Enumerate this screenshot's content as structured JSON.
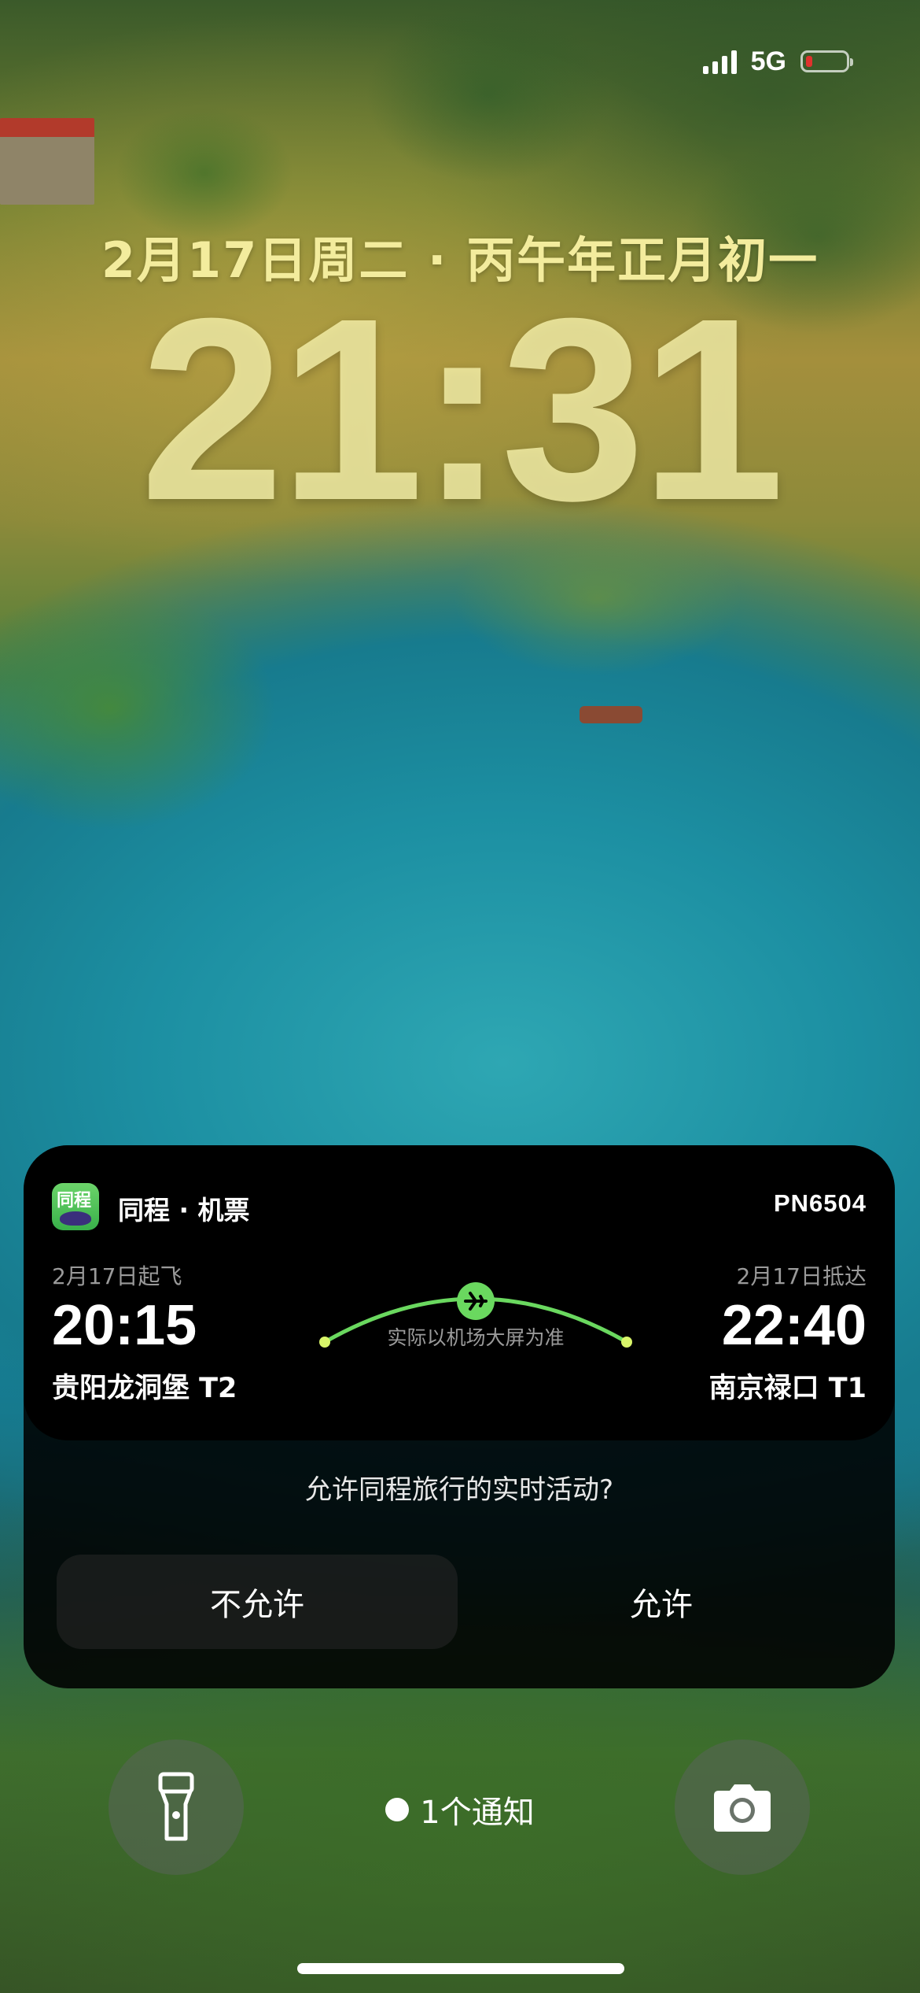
{
  "status_bar": {
    "network": "5G",
    "signal_bars": 4,
    "battery_level": 0.12,
    "battery_color": "#e0322d"
  },
  "lock_screen": {
    "date": "2月17日周二 · 丙午年正月初一",
    "time": "21:31",
    "clock_color": "#f3ec9d"
  },
  "live_activity": {
    "app_icon_text": "同程",
    "app_name": "同程 · 机票",
    "flight_number": "PN6504",
    "departure": {
      "date": "2月17日起飞",
      "time": "20:15",
      "airport": "贵阳龙洞堡 T2"
    },
    "arrival": {
      "date": "2月17日抵达",
      "time": "22:40",
      "airport": "南京禄口 T1"
    },
    "route_note": "实际以机场大屏为准",
    "accent_color": "#6ad85f",
    "plane_icon": "airplane-icon"
  },
  "permission": {
    "prompt": "允许同程旅行的实时活动?",
    "deny_label": "不允许",
    "allow_label": "允许"
  },
  "bottom": {
    "notification_text": "1个通知",
    "left_icon": "flashlight-icon",
    "right_icon": "camera-icon"
  }
}
